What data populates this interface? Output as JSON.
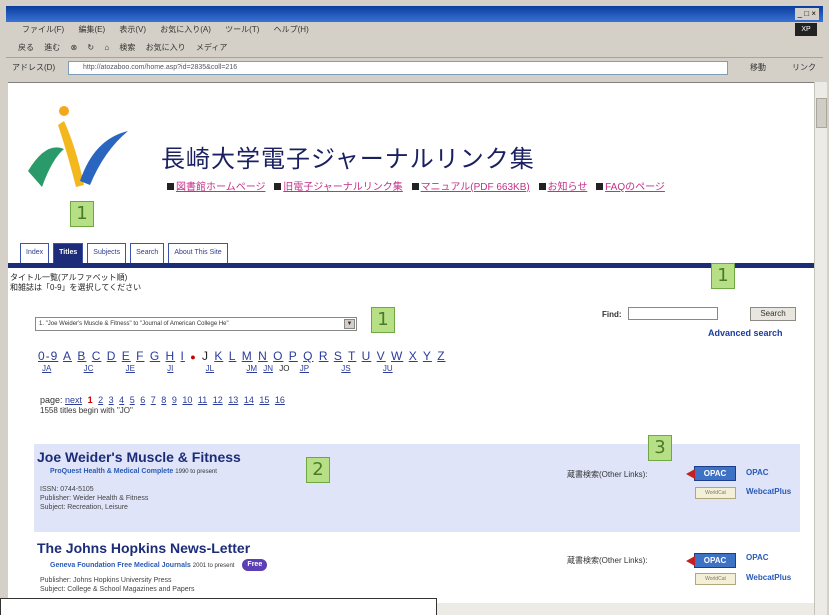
{
  "window": {
    "menu": [
      "ファイル(F)",
      "編集(E)",
      "表示(V)",
      "お気に入り(A)",
      "ツール(T)",
      "ヘルプ(H)"
    ],
    "toolbar": [
      "戻る",
      "進む",
      "検索",
      "お気に入り",
      "メディア"
    ],
    "address_label": "アドレス(D)",
    "url": "http://atozaboo.com/home.asp?id=2835&coll=216",
    "go_label": "移動",
    "links_label": "リンク"
  },
  "site": {
    "title": "長崎大学電子ジャーナルリンク集",
    "toplinks": [
      "図書館ホームページ",
      "旧電子ジャーナルリンク集",
      "マニュアル(PDF 663KB)",
      "お知らせ",
      "FAQのページ"
    ]
  },
  "annotations": {
    "logo": "1",
    "find": "1",
    "range": "1",
    "entry1": "2",
    "holdings": "3"
  },
  "tabs": [
    "Index",
    "Titles",
    "Subjects",
    "Search",
    "About This Site"
  ],
  "list_label_line1": "タイトル一覧(アルファベット順)",
  "list_label_line2": "和雑誌は「0-9」を選択してください",
  "find": {
    "label": "Find:",
    "button": "Search",
    "advanced": "Advanced search"
  },
  "range_select": "1. \"Joe Weider's Muscle & Fitness\" to \"Journal of American College He\"",
  "alphabet": [
    "0-9",
    "A",
    "B",
    "C",
    "D",
    "E",
    "F",
    "G",
    "H",
    "I",
    "J",
    "K",
    "L",
    "M",
    "N",
    "O",
    "P",
    "Q",
    "R",
    "S",
    "T",
    "U",
    "V",
    "W",
    "X",
    "Y",
    "Z"
  ],
  "subletters": [
    "JA",
    "JC",
    "JE",
    "JI",
    "JL",
    "JM",
    "JN",
    "JO",
    "JP",
    "JS",
    "JU"
  ],
  "pager": {
    "label": "page:",
    "next": "next",
    "current": "1",
    "pages": [
      "2",
      "3",
      "4",
      "5",
      "6",
      "7",
      "8",
      "9",
      "10",
      "11",
      "12",
      "13",
      "14",
      "15",
      "16"
    ],
    "count": "1558 titles begin with \"JO\""
  },
  "entries": [
    {
      "title": "Joe Weider's Muscle & Fitness",
      "package": "ProQuest Health & Medical Complete",
      "coverage": "1990 to present",
      "issn": "ISSN: 0744-5105",
      "publisher": "Publisher: Weider Health & Fitness",
      "subject": "Subject: Recreation, Leisure",
      "holdings": "蔵書検索(Other Links):",
      "opac_badge": "OPAC",
      "opac_link": "OPAC",
      "wc_badge": "WorldCat",
      "wc_link": "WebcatPlus"
    },
    {
      "title": "The Johns Hopkins News-Letter",
      "package": "Geneva Foundation Free Medical Journals",
      "coverage": "2001 to present",
      "free": "Free",
      "publisher": "Publisher: Johns Hopkins University Press",
      "subject": "Subject: College & School Magazines and Papers",
      "holdings": "蔵書検索(Other Links):",
      "opac_badge": "OPAC",
      "opac_link": "OPAC",
      "wc_badge": "WorldCat",
      "wc_link": "WebcatPlus"
    }
  ]
}
